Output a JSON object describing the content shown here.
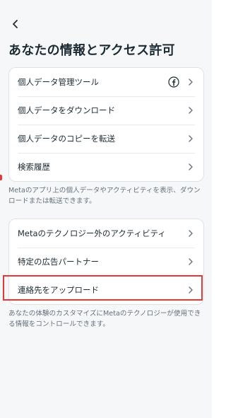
{
  "header": {
    "title": "あなたの情報とアクセス許可"
  },
  "section1": {
    "items": [
      {
        "label": "個人データ管理ツール",
        "icon": "facebook-icon"
      },
      {
        "label": "個人データをダウンロード"
      },
      {
        "label": "個人データのコピーを転送"
      },
      {
        "label": "検索履歴"
      }
    ],
    "note": "Metaのアプリ上の個人データやアクティビティを表示、ダウンロードまたは転送できます。"
  },
  "section2": {
    "items": [
      {
        "label": "Metaのテクノロジー外のアクティビティ"
      },
      {
        "label": "特定の広告パートナー"
      },
      {
        "label": "連絡先をアップロード"
      }
    ],
    "note": "あなたの体験のカスタマイズにMetaのテクノロジーが使用できる情報をコントロールできます。"
  },
  "colors": {
    "highlight": "#e53935",
    "text": "#1c2b33",
    "secondary_text": "#65717c"
  }
}
